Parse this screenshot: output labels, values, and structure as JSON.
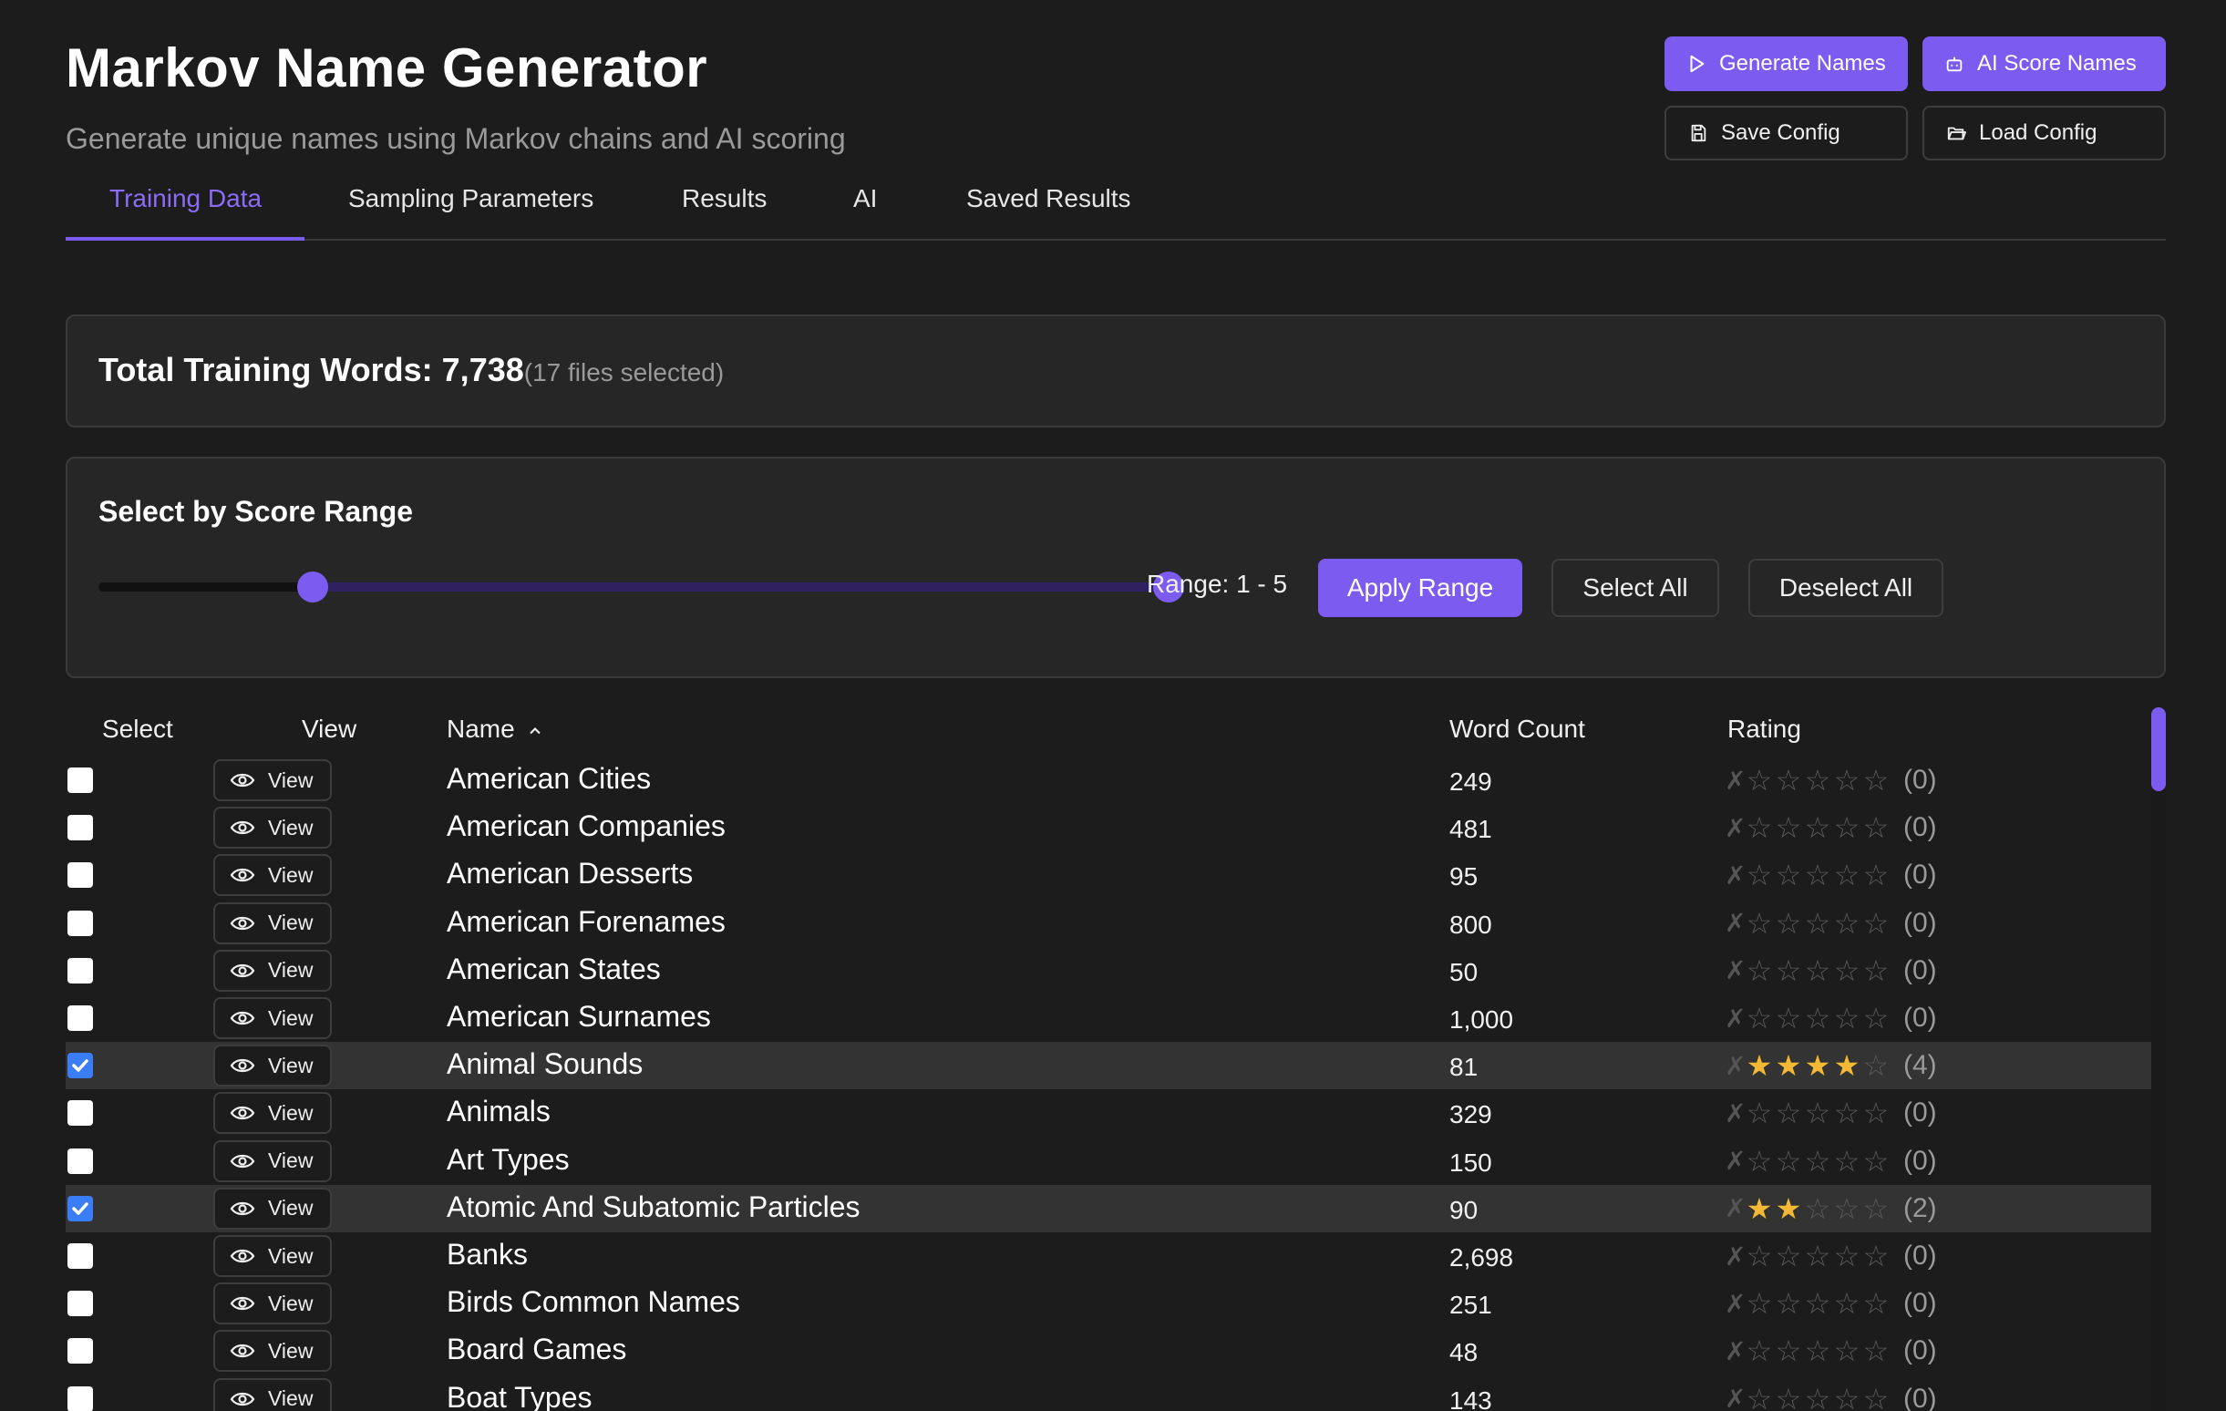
{
  "header": {
    "title": "Markov Name Generator",
    "subtitle": "Generate unique names using Markov chains and AI scoring",
    "buttons": {
      "generate": "Generate Names",
      "ai_score": "AI Score Names",
      "save": "Save Config",
      "load": "Load Config"
    }
  },
  "tabs": [
    "Training Data",
    "Sampling Parameters",
    "Results",
    "AI",
    "Saved Results"
  ],
  "active_tab": "Training Data",
  "summary": {
    "label": "Total Training Words: 7,738",
    "files": "(17 files selected)"
  },
  "range": {
    "title": "Select by Score Range",
    "min": 1,
    "max": 5,
    "scale_min": 0,
    "scale_max": 5,
    "text": "Range: 1 - 5",
    "apply": "Apply Range",
    "select_all": "Select All",
    "deselect_all": "Deselect All"
  },
  "table": {
    "headers": {
      "select": "Select",
      "view": "View",
      "name": "Name",
      "count": "Word Count",
      "rating": "Rating"
    },
    "view_label": "View",
    "rows": [
      {
        "name": "American Cities",
        "count": "249",
        "rating": 0,
        "rating_text": "(0)",
        "checked": false
      },
      {
        "name": "American Companies",
        "count": "481",
        "rating": 0,
        "rating_text": "(0)",
        "checked": false
      },
      {
        "name": "American Desserts",
        "count": "95",
        "rating": 0,
        "rating_text": "(0)",
        "checked": false
      },
      {
        "name": "American Forenames",
        "count": "800",
        "rating": 0,
        "rating_text": "(0)",
        "checked": false
      },
      {
        "name": "American States",
        "count": "50",
        "rating": 0,
        "rating_text": "(0)",
        "checked": false
      },
      {
        "name": "American Surnames",
        "count": "1,000",
        "rating": 0,
        "rating_text": "(0)",
        "checked": false
      },
      {
        "name": "Animal Sounds",
        "count": "81",
        "rating": 4,
        "rating_text": "(4)",
        "checked": true
      },
      {
        "name": "Animals",
        "count": "329",
        "rating": 0,
        "rating_text": "(0)",
        "checked": false
      },
      {
        "name": "Art Types",
        "count": "150",
        "rating": 0,
        "rating_text": "(0)",
        "checked": false
      },
      {
        "name": "Atomic And Subatomic Particles",
        "count": "90",
        "rating": 2,
        "rating_text": "(2)",
        "checked": true
      },
      {
        "name": "Banks",
        "count": "2,698",
        "rating": 0,
        "rating_text": "(0)",
        "checked": false
      },
      {
        "name": "Birds Common Names",
        "count": "251",
        "rating": 0,
        "rating_text": "(0)",
        "checked": false
      },
      {
        "name": "Board Games",
        "count": "48",
        "rating": 0,
        "rating_text": "(0)",
        "checked": false
      },
      {
        "name": "Boat Types",
        "count": "143",
        "rating": 0,
        "rating_text": "(0)",
        "checked": false
      }
    ]
  },
  "icons": {
    "generate": "play-icon",
    "ai_score": "robot-icon",
    "save": "save-icon",
    "load": "folder-open-icon",
    "view": "eye-icon",
    "sort": "chevron-up-icon"
  },
  "colors": {
    "accent": "#7c5cf0",
    "star": "#f3b934",
    "checkbox": "#3b7df6",
    "background": "#1c1c1c"
  }
}
